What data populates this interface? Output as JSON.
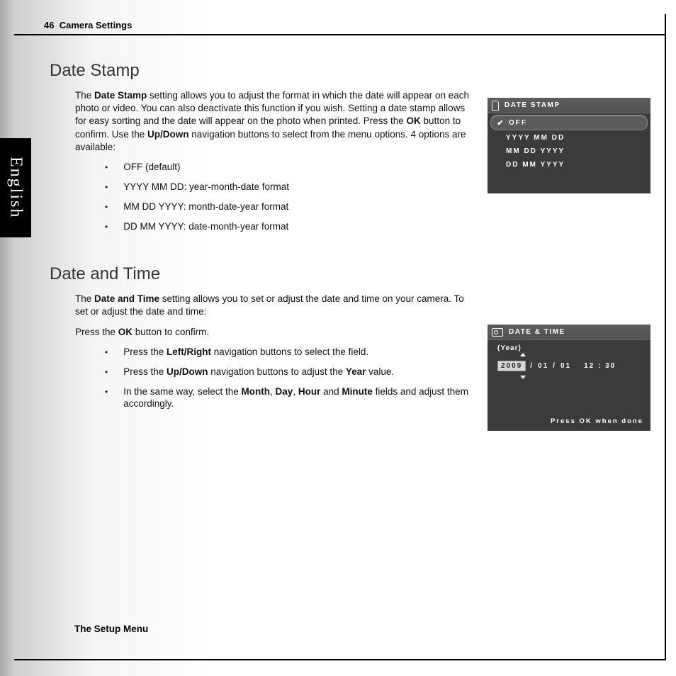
{
  "page": {
    "number": "46",
    "header": "Camera Settings",
    "side_tab": "English",
    "footer": "The Setup Menu"
  },
  "section1": {
    "heading": "Date Stamp",
    "intro_pre": "The ",
    "intro_bold1": "Date Stamp",
    "intro_mid1": " setting allows you to adjust the format in which the date will appear on each photo or video. You can also deactivate this function if you wish. Setting a date stamp allows for easy sorting and the date will appear on the photo when printed. Press the ",
    "intro_bold2": "OK",
    "intro_mid2": " button to confirm. Use the ",
    "intro_bold3": "Up/Down",
    "intro_mid3": " navigation buttons to select from the menu options. 4 options are available:",
    "bullets": [
      "OFF (default)",
      "YYYY MM DD: year-month-date format",
      "MM DD YYYY: month-date-year format",
      "DD MM YYYY: date-month-year format"
    ]
  },
  "section2": {
    "heading": "Date and Time",
    "p1_pre": "The ",
    "p1_b1": "Date and Time",
    "p1_post": " setting allows you to set or adjust the date and time on your camera. To set or adjust the date and time:",
    "p2_pre": "Press the ",
    "p2_b1": "OK",
    "p2_post": " button to confirm.",
    "b1_pre": "Press the ",
    "b1_b": "Left/Right",
    "b1_post": " navigation buttons to select the field.",
    "b2_pre": "Press the ",
    "b2_b": "Up/Down",
    "b2_mid": " navigation buttons to adjust the ",
    "b2_b2": "Year",
    "b2_post": " value.",
    "b3_pre": "In the same way, select the ",
    "b3_b1": "Month",
    "b3_s1": ", ",
    "b3_b2": "Day",
    "b3_s2": ", ",
    "b3_b3": "Hour",
    "b3_s3": " and ",
    "b3_b4": "Minute",
    "b3_post": " fields and adjust them accordingly."
  },
  "lcd1": {
    "title": "DATE STAMP",
    "items": [
      "OFF",
      "YYYY MM DD",
      "MM DD YYYY",
      "DD MM YYYY"
    ],
    "selected_index": 0
  },
  "lcd2": {
    "title": "DATE & TIME",
    "field_label": "(Year)",
    "year": "2009",
    "sep1": "/",
    "month": "01",
    "sep2": "/",
    "day": "01",
    "time": "12 : 30",
    "hint": "Press OK when done"
  }
}
